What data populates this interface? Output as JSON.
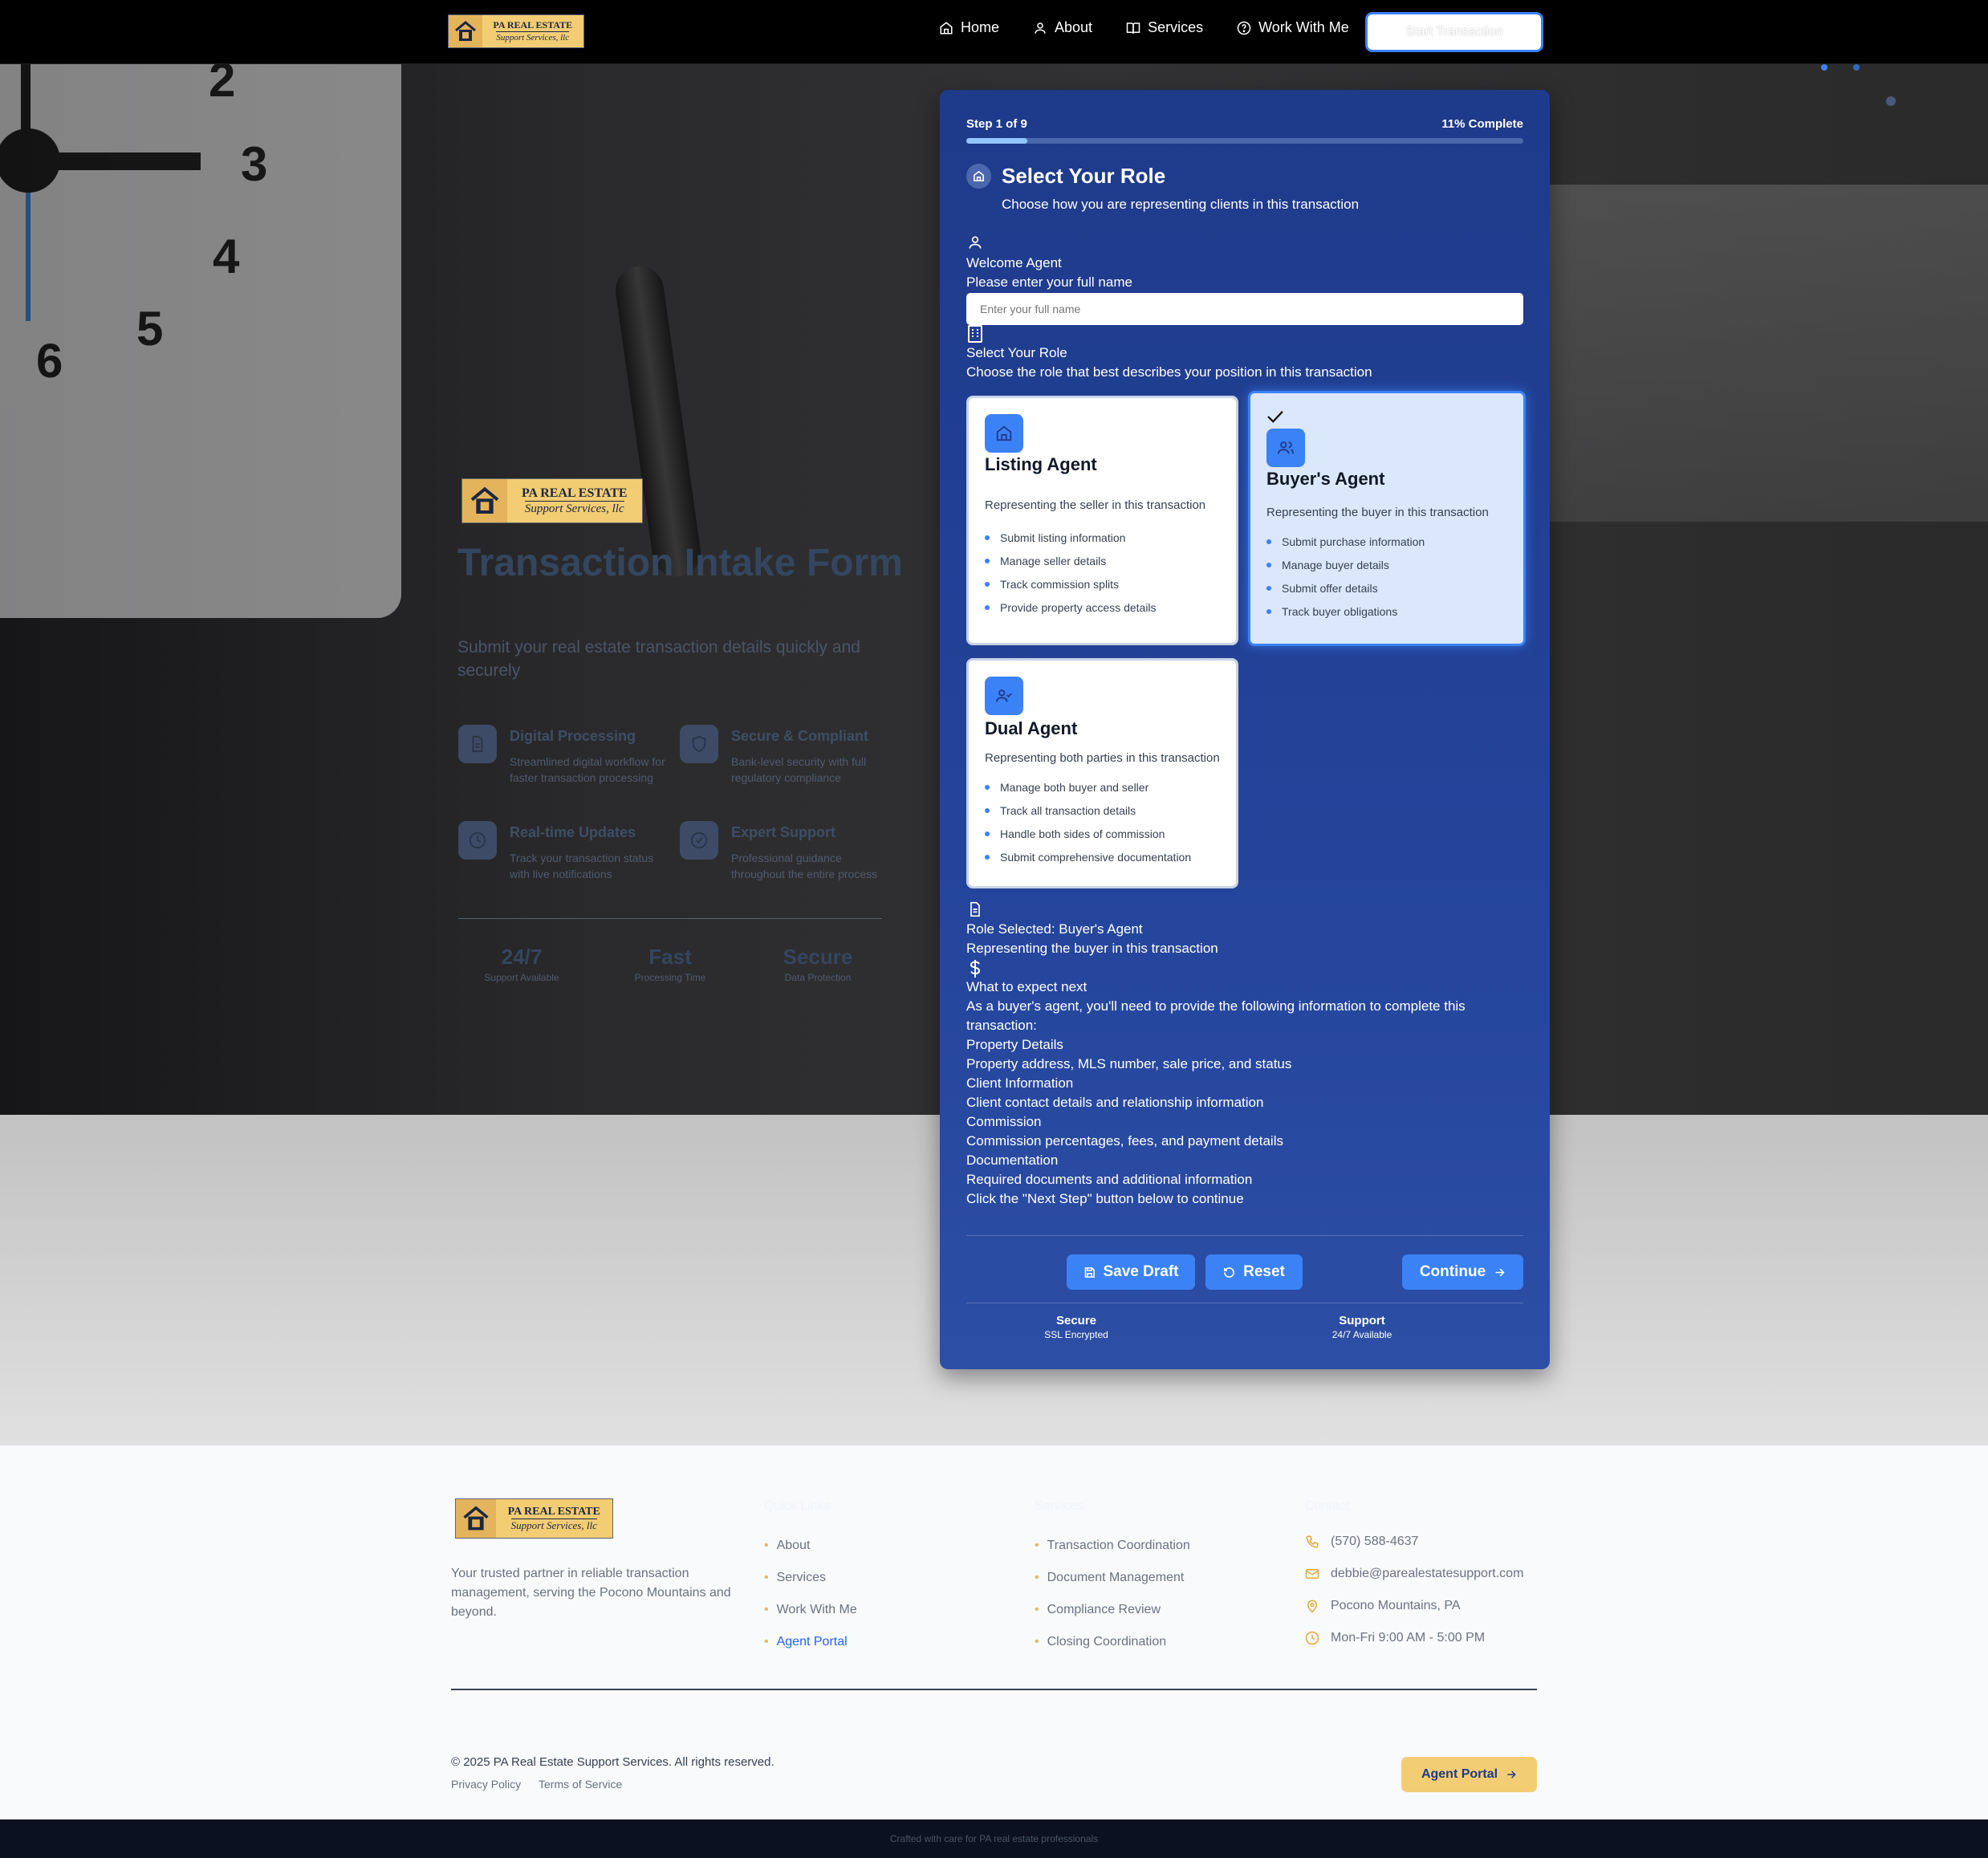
{
  "brand": {
    "line1": "PA REAL ESTATE",
    "line2": "Support Services, llc"
  },
  "nav": {
    "items": [
      {
        "label": "Home",
        "icon": "home-icon"
      },
      {
        "label": "About",
        "icon": "user-icon"
      },
      {
        "label": "Services",
        "icon": "book-icon"
      },
      {
        "label": "Work With Me",
        "icon": "help-circle-icon"
      }
    ],
    "cta_label": "Start Transaction"
  },
  "hero": {
    "title": "Transaction Intake Form",
    "subtitle": "Submit your real estate transaction details quickly and securely",
    "features": [
      {
        "title": "Digital Processing",
        "desc": "Streamlined digital workflow for faster transaction processing",
        "icon": "file-text-icon"
      },
      {
        "title": "Secure & Compliant",
        "desc": "Bank-level security with full regulatory compliance",
        "icon": "shield-icon"
      },
      {
        "title": "Real-time Updates",
        "desc": "Track your transaction status with live notifications",
        "icon": "clock-icon"
      },
      {
        "title": "Expert Support",
        "desc": "Professional guidance throughout the entire process",
        "icon": "check-circle-icon"
      }
    ],
    "stats": [
      {
        "value": "24/7",
        "label": "Support Available"
      },
      {
        "value": "Fast",
        "label": "Processing Time"
      },
      {
        "value": "Secure",
        "label": "Data Protection"
      }
    ]
  },
  "form": {
    "step_label": "Step 1 of 9",
    "complete_label": "11% Complete",
    "progress": 0.11,
    "title": "Select Your Role",
    "subtitle": "Choose how you are representing clients in this transaction",
    "welcome_heading": "Welcome Agent",
    "name_prompt": "Please enter your full name",
    "name_value": "",
    "name_placeholder": "Enter your full name",
    "role_heading": "Select Your Role",
    "role_prompt": "Choose the role that best describes your position in this transaction",
    "roles": [
      {
        "title": "Listing Agent",
        "desc": "Representing the seller in this transaction",
        "selected": false,
        "items": [
          "Submit listing information",
          "Manage seller details",
          "Track commission splits",
          "Provide property access details"
        ]
      },
      {
        "title": "Buyer's Agent",
        "desc": "Representing the buyer in this transaction",
        "selected": true,
        "items": [
          "Submit purchase information",
          "Manage buyer details",
          "Submit offer details",
          "Track buyer obligations"
        ]
      },
      {
        "title": "Dual Agent",
        "desc": "Representing both parties in this transaction",
        "selected": false,
        "items": [
          "Manage both buyer and seller",
          "Track all transaction details",
          "Handle both sides of commission",
          "Submit comprehensive documentation"
        ]
      }
    ],
    "selected_title": "Role Selected: Buyer's Agent",
    "selected_desc": "Representing the buyer in this transaction",
    "expect_heading": "What to expect next",
    "expect_intro_1": "As a buyer's agent, you'll need to provide the following information to complete this",
    "expect_intro_2": "transaction:",
    "expect_items": [
      {
        "title": "Property Details",
        "desc": "Property address, MLS number, sale price, and status"
      },
      {
        "title": "Client Information",
        "desc": "Client contact details and relationship information"
      },
      {
        "title": "Commission",
        "desc": "Commission percentages, fees, and payment details"
      },
      {
        "title": "Documentation",
        "desc": "Required documents and additional information"
      }
    ],
    "continue_hint": "Click the \"Next Step\" button below to continue",
    "buttons": {
      "save": "Save Draft",
      "reset": "Reset",
      "continue": "Continue"
    },
    "badges": [
      {
        "title": "Secure",
        "sub": "SSL Encrypted"
      },
      {
        "title": "Support",
        "sub": "24/7 Available"
      }
    ]
  },
  "footer": {
    "tagline_1": "Your trusted partner in reliable transaction",
    "tagline_2": "management, serving the Pocono Mountains and",
    "tagline_3": "beyond.",
    "quick_heading": "Quick Links",
    "quick_links": [
      "About",
      "Services",
      "Work With Me",
      "Agent Portal"
    ],
    "services_heading": "Services",
    "services": [
      "Transaction Coordination",
      "Document Management",
      "Compliance Review",
      "Closing Coordination"
    ],
    "contact_heading": "Contact",
    "contact": [
      {
        "icon": "phone-icon",
        "text": "(570) 588-4637"
      },
      {
        "icon": "mail-icon",
        "text": "debbie@parealestatesupport.com"
      },
      {
        "icon": "map-pin-icon",
        "text": "Pocono Mountains, PA"
      },
      {
        "icon": "clock-icon",
        "text": "Mon-Fri 9:00 AM - 5:00 PM"
      }
    ],
    "copyright": "© 2025 PA Real Estate Support Services. All rights reserved.",
    "privacy": "Privacy Policy",
    "terms": "Terms of Service",
    "portal_button": "Agent Portal",
    "crafted": "Crafted with care for PA real estate professionals"
  },
  "colors": {
    "accent": "#3b82f6",
    "panel": "#1e3a8a",
    "gold": "#f3cd73",
    "nav": "#000000"
  }
}
